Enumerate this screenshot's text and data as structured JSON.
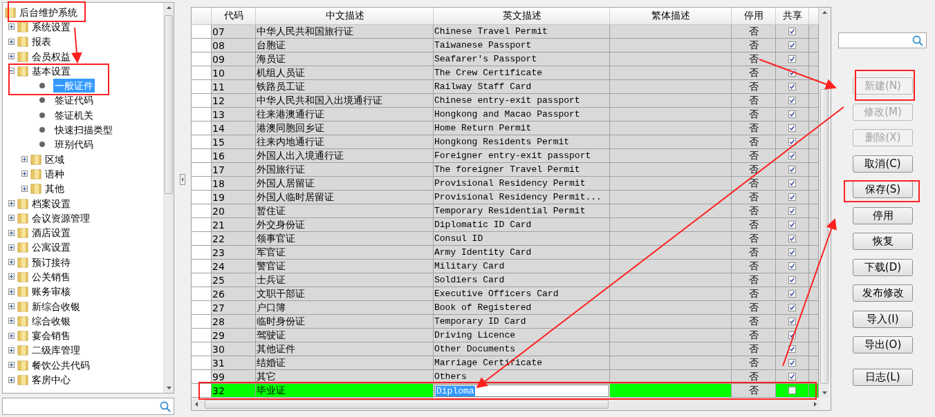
{
  "tree": {
    "root": {
      "label": "后台维护系统",
      "kind": "folder",
      "selected": false,
      "children": [
        {
          "label": "系统设置",
          "kind": "folder",
          "expanded": false,
          "selected": false
        },
        {
          "label": "报表",
          "kind": "folder",
          "expanded": false,
          "selected": false
        },
        {
          "label": "会员权益",
          "kind": "folder",
          "expanded": false,
          "selected": false
        },
        {
          "label": "基本设置",
          "kind": "folder",
          "expanded": true,
          "selected": false,
          "children": [
            {
              "label": "一般证件",
              "kind": "leaf",
              "selected": true
            },
            {
              "label": "签证代码",
              "kind": "leaf",
              "selected": false
            },
            {
              "label": "签证机关",
              "kind": "leaf",
              "selected": false
            },
            {
              "label": "快速扫描类型",
              "kind": "leaf",
              "selected": false
            },
            {
              "label": "班别代码",
              "kind": "leaf",
              "selected": false
            },
            {
              "label": "区域",
              "kind": "folder",
              "expanded": false,
              "selected": false
            },
            {
              "label": "语种",
              "kind": "folder",
              "expanded": false,
              "selected": false
            },
            {
              "label": "其他",
              "kind": "folder",
              "expanded": false,
              "selected": false
            }
          ]
        },
        {
          "label": "档案设置",
          "kind": "folder",
          "expanded": false,
          "selected": false
        },
        {
          "label": "会议资源管理",
          "kind": "folder",
          "expanded": false,
          "selected": false
        },
        {
          "label": "酒店设置",
          "kind": "folder",
          "expanded": false,
          "selected": false
        },
        {
          "label": "公寓设置",
          "kind": "folder",
          "expanded": false,
          "selected": false
        },
        {
          "label": "预订接待",
          "kind": "folder",
          "expanded": false,
          "selected": false
        },
        {
          "label": "公关销售",
          "kind": "folder",
          "expanded": false,
          "selected": false
        },
        {
          "label": "账务审核",
          "kind": "folder",
          "expanded": false,
          "selected": false
        },
        {
          "label": "新综合收银",
          "kind": "folder",
          "expanded": false,
          "selected": false
        },
        {
          "label": "综合收银",
          "kind": "folder",
          "expanded": false,
          "selected": false
        },
        {
          "label": "宴会销售",
          "kind": "folder",
          "expanded": false,
          "selected": false
        },
        {
          "label": "二级库管理",
          "kind": "folder",
          "expanded": false,
          "selected": false
        },
        {
          "label": "餐饮公共代码",
          "kind": "folder",
          "expanded": false,
          "selected": false
        },
        {
          "label": "客房中心",
          "kind": "folder",
          "expanded": false,
          "selected": false
        }
      ]
    }
  },
  "grid": {
    "columns": [
      "代码",
      "中文描述",
      "英文描述",
      "繁体描述",
      "停用",
      "共享"
    ],
    "rows": [
      {
        "code": "07",
        "chinese": "中华人民共和国旅行证",
        "english": "Chinese Travel Permit",
        "disabled": "否",
        "shared": true,
        "new": false
      },
      {
        "code": "08",
        "chinese": "台胞证",
        "english": "Taiwanese Passport",
        "disabled": "否",
        "shared": true,
        "new": false
      },
      {
        "code": "09",
        "chinese": "海员证",
        "english": "Seafarer's Passport",
        "disabled": "否",
        "shared": true,
        "new": false
      },
      {
        "code": "10",
        "chinese": "机组人员证",
        "english": "The Crew Certificate",
        "disabled": "否",
        "shared": true,
        "new": false
      },
      {
        "code": "11",
        "chinese": "铁路员工证",
        "english": "Railway Staff Card",
        "disabled": "否",
        "shared": true,
        "new": false
      },
      {
        "code": "12",
        "chinese": "中华人民共和国入出境通行证",
        "english": "Chinese entry-exit passport",
        "disabled": "否",
        "shared": true,
        "new": false
      },
      {
        "code": "13",
        "chinese": "往来港澳通行证",
        "english": "Hongkong and Macao Passport",
        "disabled": "否",
        "shared": true,
        "new": false
      },
      {
        "code": "14",
        "chinese": "港澳同胞回乡证",
        "english": "Home Return Permit",
        "disabled": "否",
        "shared": true,
        "new": false
      },
      {
        "code": "15",
        "chinese": "往来内地通行证",
        "english": "Hongkong Residents Permit",
        "disabled": "否",
        "shared": true,
        "new": false
      },
      {
        "code": "16",
        "chinese": "外国人出入境通行证",
        "english": "Foreigner entry-exit passport",
        "disabled": "否",
        "shared": true,
        "new": false
      },
      {
        "code": "17",
        "chinese": "外国旅行证",
        "english": "The foreigner Travel Permit",
        "disabled": "否",
        "shared": true,
        "new": false
      },
      {
        "code": "18",
        "chinese": "外国人居留证",
        "english": "Provisional Residency Permit",
        "disabled": "否",
        "shared": true,
        "new": false
      },
      {
        "code": "19",
        "chinese": "外国人临时居留证",
        "english": "Provisional Residency Permit...",
        "disabled": "否",
        "shared": true,
        "new": false
      },
      {
        "code": "20",
        "chinese": "暂住证",
        "english": "Temporary Residential Permit",
        "disabled": "否",
        "shared": true,
        "new": false
      },
      {
        "code": "21",
        "chinese": "外交身份证",
        "english": "Diplomatic ID Card",
        "disabled": "否",
        "shared": true,
        "new": false
      },
      {
        "code": "22",
        "chinese": "领事官证",
        "english": "Consul ID",
        "disabled": "否",
        "shared": true,
        "new": false
      },
      {
        "code": "23",
        "chinese": "军官证",
        "english": "Army Identity Card",
        "disabled": "否",
        "shared": true,
        "new": false
      },
      {
        "code": "24",
        "chinese": "警官证",
        "english": "Military Card",
        "disabled": "否",
        "shared": true,
        "new": false
      },
      {
        "code": "25",
        "chinese": "士兵证",
        "english": "Soldiers Card",
        "disabled": "否",
        "shared": true,
        "new": false
      },
      {
        "code": "26",
        "chinese": "文职干部证",
        "english": "Executive Officers Card",
        "disabled": "否",
        "shared": true,
        "new": false
      },
      {
        "code": "27",
        "chinese": "户口簿",
        "english": "Book of Registered",
        "disabled": "否",
        "shared": true,
        "new": false
      },
      {
        "code": "28",
        "chinese": "临时身份证",
        "english": "Temporary ID Card",
        "disabled": "否",
        "shared": true,
        "new": false
      },
      {
        "code": "29",
        "chinese": "驾驶证",
        "english": "Driving Licence",
        "disabled": "否",
        "shared": true,
        "new": false
      },
      {
        "code": "30",
        "chinese": "其他证件",
        "english": "Other Documents",
        "disabled": "否",
        "shared": true,
        "new": false
      },
      {
        "code": "31",
        "chinese": "结婚证",
        "english": "Marriage Certificate",
        "disabled": "否",
        "shared": true,
        "new": false
      },
      {
        "code": "99",
        "chinese": "其它",
        "english": "Others",
        "disabled": "否",
        "shared": true,
        "new": false
      },
      {
        "code": "32",
        "chinese": "毕业证",
        "english": "Diploma",
        "disabled": "否",
        "shared": false,
        "new": true
      }
    ]
  },
  "actions": [
    {
      "label": "新建(N)",
      "disabled": true
    },
    {
      "label": "修改(M)",
      "disabled": true
    },
    {
      "label": "删除(X)",
      "disabled": true
    },
    {
      "label": "取消(C)",
      "disabled": false
    },
    {
      "label": "保存(S)",
      "disabled": false
    },
    {
      "label": "停用",
      "disabled": false
    },
    {
      "label": "恢复",
      "disabled": false
    },
    {
      "label": "下载(D)",
      "disabled": false
    },
    {
      "label": "发布修改",
      "disabled": false
    },
    {
      "label": "导入(I)",
      "disabled": false
    },
    {
      "label": "导出(O)",
      "disabled": false
    },
    {
      "label": "日志(L)",
      "disabled": false
    }
  ]
}
